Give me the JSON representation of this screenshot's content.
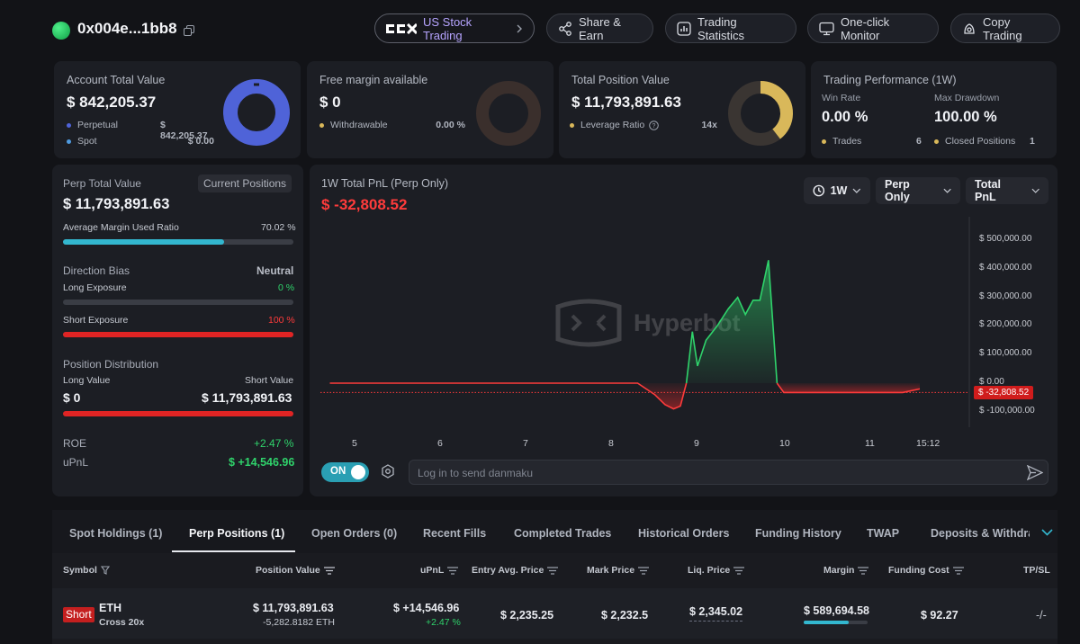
{
  "header": {
    "address": "0x004e...1bb8",
    "buttons": [
      {
        "label": "US Stock Trading",
        "icon": "us-stock-logo-icon"
      },
      {
        "label": "Share & Earn",
        "icon": "share-icon"
      },
      {
        "label": "Trading Statistics",
        "icon": "chart-icon"
      },
      {
        "label": "One-click Monitor",
        "icon": "monitor-icon"
      },
      {
        "label": "Copy Trading",
        "icon": "copy-trading-icon"
      }
    ]
  },
  "summary": {
    "account": {
      "title": "Account Total Value",
      "value": "$ 842,205.37",
      "rows": [
        {
          "label": "Perpetual",
          "value": "$ 842,205.37",
          "color": "#4f63d8"
        },
        {
          "label": "Spot",
          "value": "$ 0.00",
          "color": "#4f9be0"
        }
      ]
    },
    "margin": {
      "title": "Free margin available",
      "value": "$ 0",
      "rows": [
        {
          "label": "Withdrawable",
          "value": "0.00 %",
          "color": "#d9b85a"
        }
      ]
    },
    "position": {
      "title": "Total Position Value",
      "value": "$ 11,793,891.63",
      "rows": [
        {
          "label": "Leverage Ratio",
          "value": "14x",
          "color": "#d9b85a"
        }
      ]
    },
    "performance": {
      "title": "Trading Performance (1W)",
      "win_rate_label": "Win Rate",
      "win_rate": "0.00 %",
      "drawdown_label": "Max Drawdown",
      "drawdown": "100.00 %",
      "trades_label": "Trades",
      "trades": "6",
      "closed_label": "Closed Positions",
      "closed": "1"
    }
  },
  "left": {
    "perp_total_label": "Perp Total Value",
    "current_positions_btn": "Current Positions",
    "perp_total": "$ 11,793,891.63",
    "avg_margin_label": "Average Margin Used Ratio",
    "avg_margin": "70.02 %",
    "avg_margin_pct": 70.02,
    "direction_label": "Direction Bias",
    "direction": "Neutral",
    "long_label": "Long Exposure",
    "long_value": "0 %",
    "long_pct": 0,
    "short_label": "Short Exposure",
    "short_value": "100 %",
    "short_pct": 100,
    "distribution_label": "Position Distribution",
    "long_value_label": "Long Value",
    "short_value_label": "Short Value",
    "long_amount": "$ 0",
    "short_amount": "$ 11,793,891.63",
    "roe_label": "ROE",
    "roe": "+2.47 %",
    "upnl_label": "uPnL",
    "upnl": "$ +14,546.96"
  },
  "chart_panel": {
    "title": "1W Total PnL (Perp Only)",
    "value": "$ -32,808.52",
    "filters": [
      "1W",
      "Perp Only",
      "Total PnL"
    ],
    "watermark": "Hyperbot",
    "current_label": "$ -32,808.52",
    "toggle": "ON",
    "danmaku_placeholder": "Log in to send danmaku"
  },
  "chart_data": {
    "type": "area",
    "title": "1W Total PnL (Perp Only)",
    "x_ticks": [
      "5",
      "6",
      "7",
      "8",
      "9",
      "10",
      "11",
      "15:12"
    ],
    "y_ticks": [
      "$ 500,000.00",
      "$ 400,000.00",
      "$ 300,000.00",
      "$ 200,000.00",
      "$ 100,000.00",
      "$ 0.00",
      "$ -100,000.00"
    ],
    "ylim": [
      -100000,
      500000
    ],
    "grid": false,
    "x": [
      4.7,
      5.5,
      6.5,
      7.5,
      8.3,
      8.5,
      8.62,
      8.72,
      8.8,
      8.87,
      8.94,
      9.0,
      9.1,
      9.23,
      9.36,
      9.47,
      9.56,
      9.65,
      9.73,
      9.83,
      9.93,
      10.01,
      10.15,
      10.5,
      11.0,
      11.4,
      11.6
    ],
    "y": [
      0,
      0,
      0,
      0,
      0,
      -40000,
      -75000,
      -90000,
      -80000,
      0,
      180000,
      60000,
      150000,
      200000,
      260000,
      300000,
      240000,
      290000,
      290000,
      430000,
      0,
      -32808,
      -32808,
      -32808,
      -32808,
      -32808,
      -20000
    ],
    "current": -32808.52
  },
  "tabs": [
    "Spot Holdings (1)",
    "Perp Positions (1)",
    "Open Orders (0)",
    "Recent Fills",
    "Completed Trades",
    "Historical Orders",
    "Funding History",
    "TWAP",
    "Deposits & Withdraw"
  ],
  "table": {
    "columns": [
      "Symbol",
      "Position Value",
      "uPnL",
      "Entry Avg. Price",
      "Mark Price",
      "Liq. Price",
      "Margin",
      "Funding Cost",
      "TP/SL"
    ],
    "row": {
      "side": "Short",
      "symbol": "ETH",
      "mode": "Cross 20x",
      "position_value": "$ 11,793,891.63",
      "position_size": "-5,282.8182 ETH",
      "upnl": "$ +14,546.96",
      "upnl_pct": "+2.47 %",
      "entry": "$ 2,235.25",
      "mark": "$ 2,232.5",
      "liq": "$ 2,345.02",
      "margin": "$ 589,694.58",
      "funding": "$ 92.27",
      "tpsl": "-/-"
    }
  }
}
